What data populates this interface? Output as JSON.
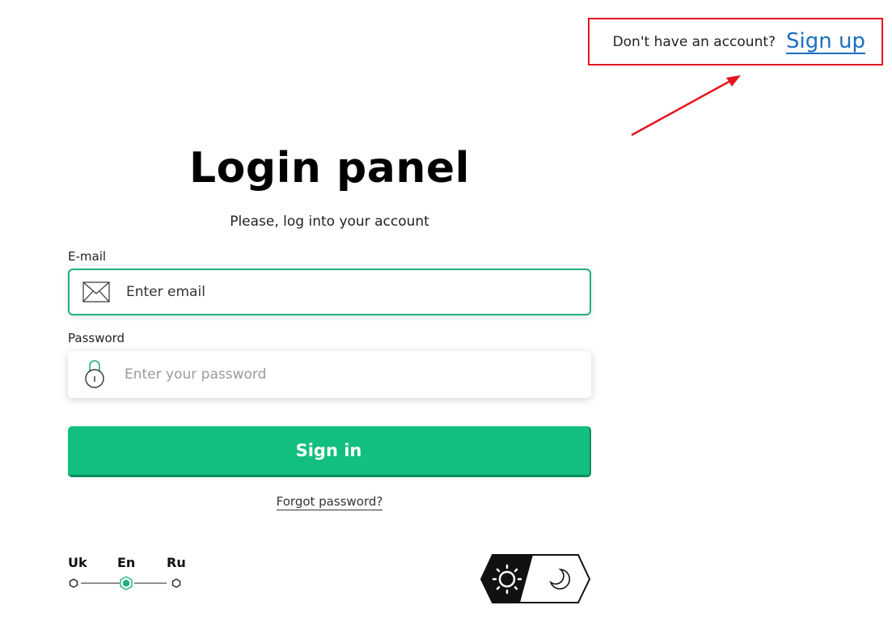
{
  "header": {
    "no_account_text": "Don't have an account?",
    "signup_label": "Sign up"
  },
  "main": {
    "title": "Login panel",
    "subtitle": "Please, log into your account",
    "email": {
      "label": "E-mail",
      "placeholder": "Enter email",
      "value": ""
    },
    "password": {
      "label": "Password",
      "placeholder": "Enter your password",
      "value": ""
    },
    "signin_label": "Sign in",
    "forgot_label": "Forgot password?"
  },
  "languages": {
    "items": [
      "Uk",
      "En",
      "Ru"
    ],
    "selected": "En"
  },
  "theme_toggle": {
    "options": [
      "sun-icon",
      "moon-icon"
    ],
    "selected": "light"
  },
  "annotation": {
    "box_color": "#e5151f",
    "arrow_color": "#e5151f"
  },
  "colors": {
    "accent": "#12bf7f",
    "link": "#1b6fc2"
  }
}
